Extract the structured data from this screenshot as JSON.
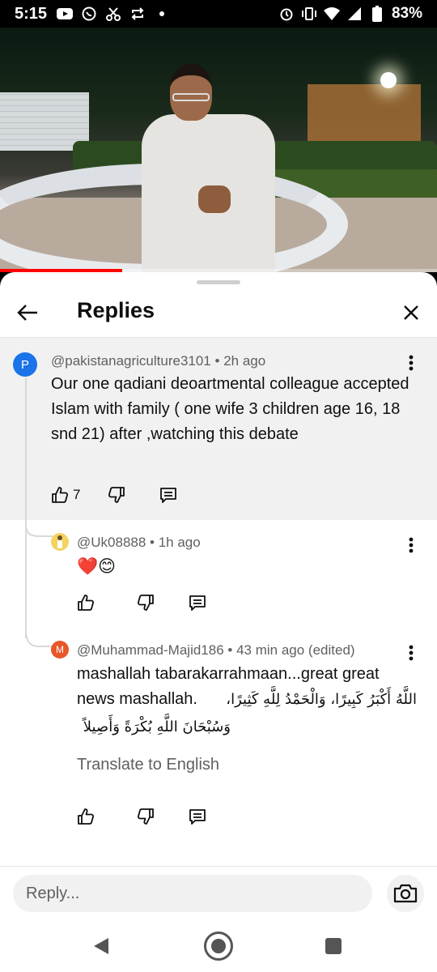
{
  "status_bar": {
    "time": "5:15",
    "battery": "83%",
    "icons_left": [
      "youtube-icon",
      "whatsapp-icon",
      "scissors-icon",
      "repeat-icon",
      "dot-icon"
    ],
    "icons_right": [
      "alarm-icon",
      "vibrate-icon",
      "wifi-icon",
      "signal-icon",
      "battery-icon"
    ]
  },
  "video": {
    "progress": 0.28,
    "progress_color": "#ff0000"
  },
  "sheet": {
    "title": "Replies"
  },
  "parent_comment": {
    "avatar_letter": "P",
    "avatar_color": "#1a73e8",
    "author": "@pakistanagriculture3101",
    "time": "• 2h ago",
    "text": "Our one qadiani deoartmental colleague accepted Islam with family ( one wife 3 children age 16, 18 snd 21) after ,watching this debate",
    "likes": "7"
  },
  "replies": [
    {
      "avatar_color": "#f4d35e",
      "author": "@Uk08888",
      "time": "• 1h ago",
      "text": "❤️😊"
    },
    {
      "avatar_letter": "M",
      "avatar_color": "#e8572a",
      "author": "@Muhammad-Majid186",
      "time": "• 43 min ago (edited)",
      "text_line1": "mashallah tabarakarrahmaan...great great",
      "text_line2_latin": "news mashallah.",
      "text_line2_arabic": "اللَّهُ أَكْبَرُ كَبِيرًا، وَالْحَمْدُ لِلَّهِ كَثِيرًا،",
      "text_line3_arabic": "وَسُبْحَانَ اللَّهِ بُكْرَةً وَأَصِيلاً",
      "translate_label": "Translate to English"
    }
  ],
  "reply_input": {
    "placeholder": "Reply..."
  }
}
